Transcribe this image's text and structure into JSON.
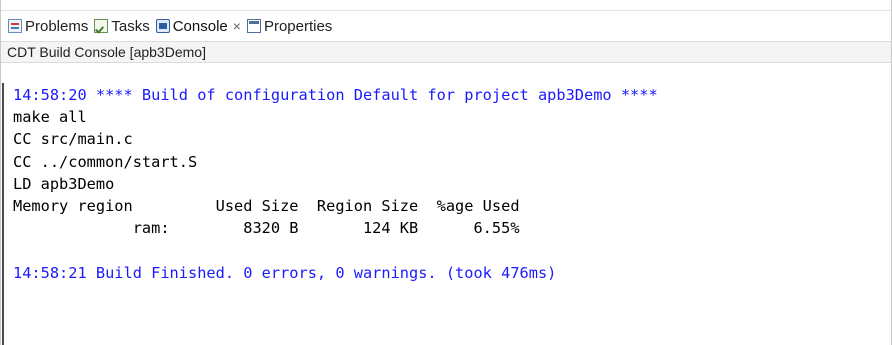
{
  "tabs": [
    {
      "label": "Problems",
      "icon": "problems-icon"
    },
    {
      "label": "Tasks",
      "icon": "tasks-icon"
    },
    {
      "label": "Console",
      "icon": "console-icon",
      "active": true,
      "close": "×"
    },
    {
      "label": "Properties",
      "icon": "properties-icon"
    }
  ],
  "console": {
    "title": "CDT Build Console [apb3Demo]",
    "lines": [
      {
        "text": "14:58:20 **** Build of configuration Default for project apb3Demo ****",
        "color": "#1a1aff"
      },
      {
        "text": "make all",
        "color": "#000000"
      },
      {
        "text": "CC src/main.c",
        "color": "#000000"
      },
      {
        "text": "CC ../common/start.S",
        "color": "#000000"
      },
      {
        "text": "LD apb3Demo",
        "color": "#000000"
      },
      {
        "text": "Memory region         Used Size  Region Size  %age Used",
        "color": "#000000"
      },
      {
        "text": "             ram:        8320 B       124 KB      6.55%",
        "color": "#000000"
      },
      {
        "text": "",
        "color": "#000000"
      },
      {
        "text": "14:58:21 Build Finished. 0 errors, 0 warnings. (took 476ms)",
        "color": "#1a1aff"
      }
    ]
  }
}
